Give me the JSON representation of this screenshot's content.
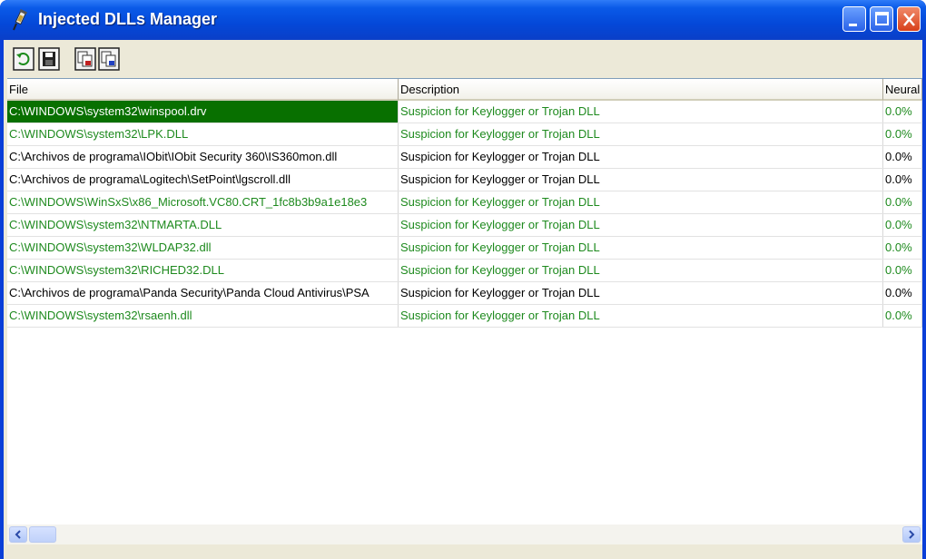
{
  "window": {
    "title": "Injected DLLs Manager",
    "colors": {
      "titlebar": "#0a5ae8",
      "selection": "#087000",
      "suspicious_text": "#1e8a1e"
    }
  },
  "toolbar": {
    "buttons": [
      {
        "icon": "refresh-icon"
      },
      {
        "icon": "save-icon"
      },
      {
        "icon": "copy-icon"
      },
      {
        "icon": "copy-alt-icon"
      }
    ]
  },
  "list": {
    "columns": [
      "File",
      "Description",
      "Neural"
    ],
    "rows": [
      {
        "file": "C:\\WINDOWS\\system32\\winspool.drv",
        "description": "Suspicion for Keylogger or Trojan DLL",
        "neural": "0.0%",
        "highlight": "green",
        "selected": true
      },
      {
        "file": "C:\\WINDOWS\\system32\\LPK.DLL",
        "description": "Suspicion for Keylogger or Trojan DLL",
        "neural": "0.0%",
        "highlight": "green",
        "selected": false
      },
      {
        "file": "C:\\Archivos de programa\\IObit\\IObit Security 360\\IS360mon.dll",
        "description": "Suspicion for Keylogger or Trojan DLL",
        "neural": "0.0%",
        "highlight": "black",
        "selected": false
      },
      {
        "file": "C:\\Archivos de programa\\Logitech\\SetPoint\\lgscroll.dll",
        "description": "Suspicion for Keylogger or Trojan DLL",
        "neural": "0.0%",
        "highlight": "black",
        "selected": false
      },
      {
        "file": "C:\\WINDOWS\\WinSxS\\x86_Microsoft.VC80.CRT_1fc8b3b9a1e18e3",
        "description": "Suspicion for Keylogger or Trojan DLL",
        "neural": "0.0%",
        "highlight": "green",
        "selected": false
      },
      {
        "file": "C:\\WINDOWS\\system32\\NTMARTA.DLL",
        "description": "Suspicion for Keylogger or Trojan DLL",
        "neural": "0.0%",
        "highlight": "green",
        "selected": false
      },
      {
        "file": "C:\\WINDOWS\\system32\\WLDAP32.dll",
        "description": "Suspicion for Keylogger or Trojan DLL",
        "neural": "0.0%",
        "highlight": "green",
        "selected": false
      },
      {
        "file": "C:\\WINDOWS\\system32\\RICHED32.DLL",
        "description": "Suspicion for Keylogger or Trojan DLL",
        "neural": "0.0%",
        "highlight": "green",
        "selected": false
      },
      {
        "file": "C:\\Archivos de programa\\Panda Security\\Panda Cloud Antivirus\\PSA",
        "description": "Suspicion for Keylogger or Trojan DLL",
        "neural": "0.0%",
        "highlight": "black",
        "selected": false
      },
      {
        "file": "C:\\WINDOWS\\system32\\rsaenh.dll",
        "description": "Suspicion for Keylogger or Trojan DLL",
        "neural": "0.0%",
        "highlight": "green",
        "selected": false
      }
    ]
  }
}
